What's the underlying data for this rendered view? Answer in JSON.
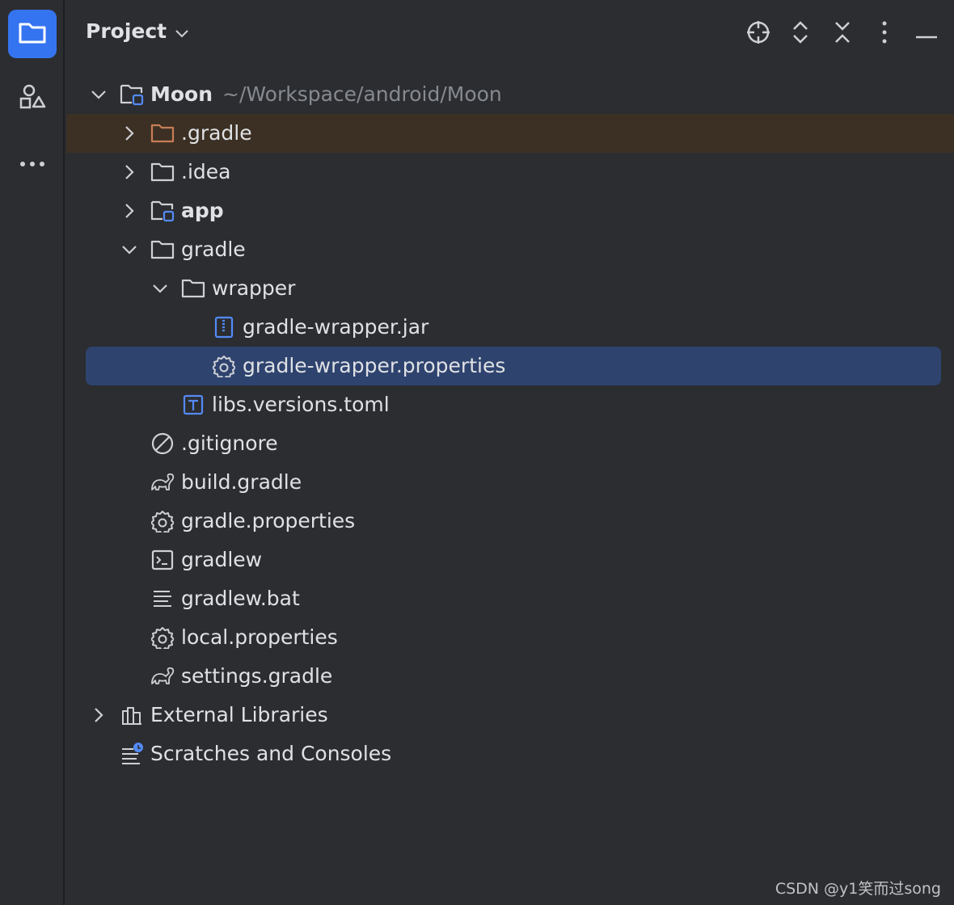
{
  "header": {
    "title": "Project"
  },
  "tree": {
    "root": {
      "label": "Moon",
      "path": "~/Workspace/android/Moon"
    },
    "items": [
      {
        "label": ".gradle"
      },
      {
        "label": ".idea"
      },
      {
        "label": "app"
      },
      {
        "label": "gradle"
      },
      {
        "label": "wrapper"
      },
      {
        "label": "gradle-wrapper.jar"
      },
      {
        "label": "gradle-wrapper.properties"
      },
      {
        "label": "libs.versions.toml"
      },
      {
        "label": ".gitignore"
      },
      {
        "label": "build.gradle"
      },
      {
        "label": "gradle.properties"
      },
      {
        "label": "gradlew"
      },
      {
        "label": "gradlew.bat"
      },
      {
        "label": "local.properties"
      },
      {
        "label": "settings.gradle"
      },
      {
        "label": "External Libraries"
      },
      {
        "label": "Scratches and Consoles"
      }
    ]
  },
  "watermark": "CSDN @y1笑而过song",
  "colors": {
    "background": "#2b2d30",
    "accent": "#3574f0",
    "selection": "#2e436e",
    "excluded_highlight": "#3c3024",
    "excluded_folder": "#c77d55",
    "text": "#dfe1e5",
    "muted": "#868a91"
  },
  "icons": {
    "strip": [
      "folder-icon",
      "shapes-icon",
      "more-horizontal-icon"
    ],
    "header": [
      "locate-icon",
      "expand-all-icon",
      "collapse-all-icon",
      "more-vertical-icon",
      "minimize-icon"
    ]
  }
}
